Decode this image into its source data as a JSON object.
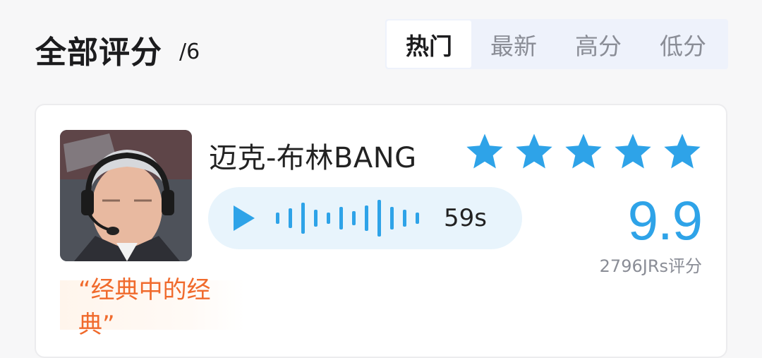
{
  "header": {
    "title": "全部评分",
    "count": "/6"
  },
  "tabs": [
    {
      "label": "热门",
      "active": true
    },
    {
      "label": "最新",
      "active": false
    },
    {
      "label": "高分",
      "active": false
    },
    {
      "label": "低分",
      "active": false
    }
  ],
  "review": {
    "name": "迈克-布林BANG",
    "voice_duration": "59s",
    "stars": 5,
    "score": "9.9",
    "votes": "2796JRs评分",
    "quote": "“经典中的经典”"
  },
  "colors": {
    "accent": "#2ea3e8",
    "quote": "#f06a2c"
  }
}
